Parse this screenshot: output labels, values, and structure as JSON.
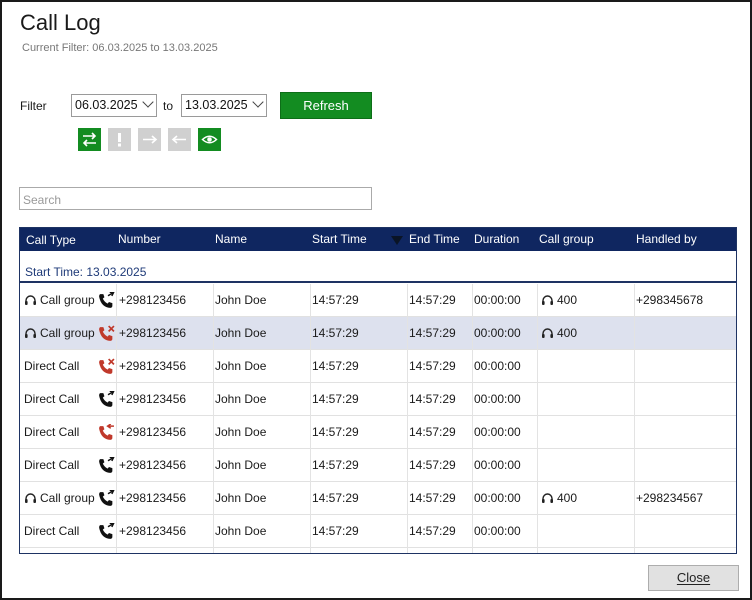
{
  "window": {
    "title": "Call Log",
    "current_filter": "Current Filter: 06.03.2025 to 13.03.2025"
  },
  "filter": {
    "label": "Filter",
    "from_date": "06.03.2025",
    "to_label": "to",
    "to_date": "13.03.2025",
    "refresh_label": "Refresh"
  },
  "toolbar": {
    "buttons": [
      {
        "icon": "swap-arrows-icon",
        "state": "on"
      },
      {
        "icon": "exclamation-icon",
        "state": "off"
      },
      {
        "icon": "arrow-right-icon",
        "state": "off"
      },
      {
        "icon": "arrow-left-icon",
        "state": "off"
      },
      {
        "icon": "eye-icon",
        "state": "on"
      }
    ],
    "active_color": "#138c21",
    "inactive_color": "#d0d0d0"
  },
  "search": {
    "placeholder": "Search"
  },
  "table": {
    "headers": {
      "call_type": "Call Type",
      "number": "Number",
      "name": "Name",
      "start_time": "Start Time",
      "end_time": "End Time",
      "duration": "Duration",
      "call_group": "Call group",
      "handled_by": "Handled by"
    },
    "sort_column": "start_time",
    "group_header": "Start Time: 13.03.2025",
    "header_color": "#0f2660",
    "rows": [
      {
        "call_type": "Call group",
        "headset": true,
        "call_icon": "incoming-call-icon",
        "number": "+298123456",
        "name": "John Doe",
        "start": "14:57:29",
        "end": "14:57:29",
        "duration": "00:00:00",
        "group": "400",
        "handled_by": "+298345678",
        "selected": false
      },
      {
        "call_type": "Call group",
        "headset": true,
        "call_icon": "missed-call-icon",
        "number": "+298123456",
        "name": "John Doe",
        "start": "14:57:29",
        "end": "14:57:29",
        "duration": "00:00:00",
        "group": "400",
        "handled_by": "",
        "selected": true
      },
      {
        "call_type": "Direct Call",
        "headset": false,
        "call_icon": "missed-call-icon",
        "number": "+298123456",
        "name": "John Doe",
        "start": "14:57:29",
        "end": "14:57:29",
        "duration": "00:00:00",
        "group": "",
        "handled_by": "",
        "selected": false
      },
      {
        "call_type": "Direct Call",
        "headset": false,
        "call_icon": "incoming-call-icon",
        "number": "+298123456",
        "name": "John Doe",
        "start": "14:57:29",
        "end": "14:57:29",
        "duration": "00:00:00",
        "group": "",
        "handled_by": "",
        "selected": false
      },
      {
        "call_type": "Direct Call",
        "headset": false,
        "call_icon": "outgoing-red-call-icon",
        "number": "+298123456",
        "name": "John Doe",
        "start": "14:57:29",
        "end": "14:57:29",
        "duration": "00:00:00",
        "group": "",
        "handled_by": "",
        "selected": false
      },
      {
        "call_type": "Direct Call",
        "headset": false,
        "call_icon": "incoming-call-icon",
        "number": "+298123456",
        "name": "John Doe",
        "start": "14:57:29",
        "end": "14:57:29",
        "duration": "00:00:00",
        "group": "",
        "handled_by": "",
        "selected": false
      },
      {
        "call_type": "Call group",
        "headset": true,
        "call_icon": "incoming-call-icon",
        "number": "+298123456",
        "name": "John Doe",
        "start": "14:57:29",
        "end": "14:57:29",
        "duration": "00:00:00",
        "group": "400",
        "handled_by": "+298234567",
        "selected": false
      },
      {
        "call_type": "Direct Call",
        "headset": false,
        "call_icon": "incoming-call-icon",
        "number": "+298123456",
        "name": "John Doe",
        "start": "14:57:29",
        "end": "14:57:29",
        "duration": "00:00:00",
        "group": "",
        "handled_by": "",
        "selected": false
      },
      {
        "call_type": "",
        "headset": false,
        "call_icon": "",
        "number": "",
        "name": "",
        "start": "",
        "end": "",
        "duration": "",
        "group": "",
        "handled_by": "",
        "selected": false
      }
    ]
  },
  "footer": {
    "close_label": "Close"
  }
}
